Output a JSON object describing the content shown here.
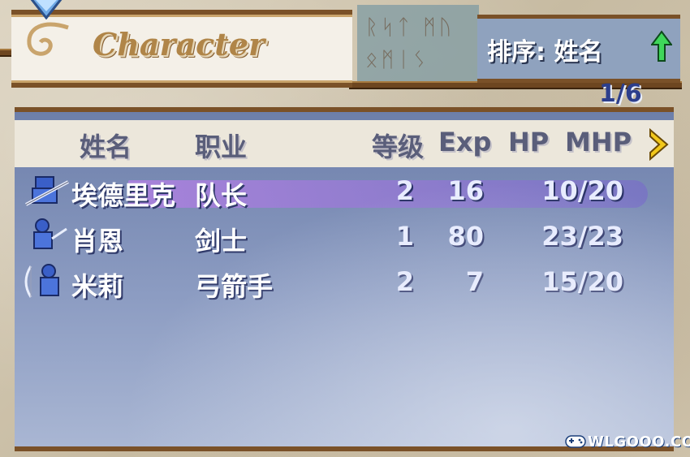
{
  "window_title": "Character",
  "sort": {
    "label": "排序: 姓名",
    "icon": "green-up-arrow-icon"
  },
  "page_indicator": "1/6",
  "columns": {
    "name": "姓名",
    "class": "职业",
    "level": "等级",
    "exp": "Exp",
    "hp": "HP",
    "mhp": "MHP",
    "next_icon": "yellow-right-arrow-icon"
  },
  "characters": [
    {
      "name": "埃德里克",
      "class": "队长",
      "level": "2",
      "exp": "16",
      "hp": "10/20",
      "selected": true,
      "portrait": "lance-knight-portrait"
    },
    {
      "name": "肖恩",
      "class": "剑士",
      "level": "1",
      "exp": "80",
      "hp": "23/23",
      "selected": false,
      "portrait": "swordsman-portrait"
    },
    {
      "name": "米莉",
      "class": "弓箭手",
      "level": "2",
      "exp": "7",
      "hp": "15/20",
      "selected": false,
      "portrait": "archer-portrait"
    }
  ],
  "watermark": "WLGOOO.COM",
  "colors": {
    "frame_brown": "#7a5128",
    "panel_blue": "#8c9cc2",
    "selection": "#aa82dc",
    "page_number": "#2c3e8c"
  }
}
